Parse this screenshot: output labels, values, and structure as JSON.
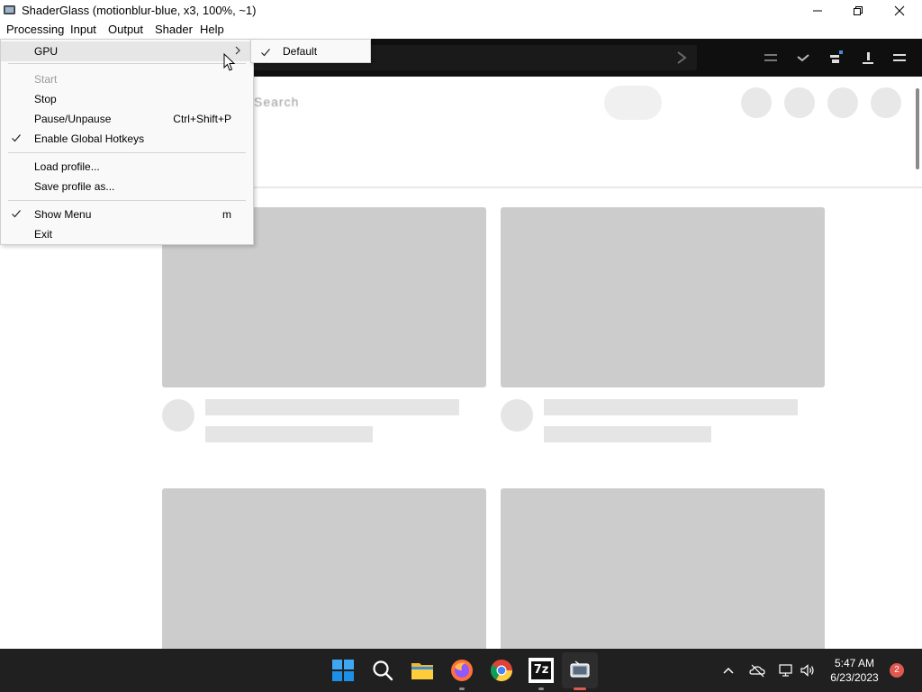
{
  "window": {
    "title": "ShaderGlass (motionblur-blue, x3, 100%, ~1)"
  },
  "menubar": {
    "items": [
      {
        "label": "Processing"
      },
      {
        "label": "Input"
      },
      {
        "label": "Output"
      },
      {
        "label": "Shader"
      },
      {
        "label": "Help"
      }
    ]
  },
  "processing_menu": {
    "items": [
      {
        "label": "GPU",
        "has_submenu": true,
        "highlighted": true
      },
      {
        "label": "Start",
        "disabled": true
      },
      {
        "label": "Stop"
      },
      {
        "label": "Pause/Unpause",
        "shortcut": "Ctrl+Shift+P"
      },
      {
        "label": "Enable Global Hotkeys",
        "checked": true
      },
      {
        "label": "Load profile..."
      },
      {
        "label": "Save profile as..."
      },
      {
        "label": "Show Menu",
        "shortcut": "m",
        "checked": true
      },
      {
        "label": "Exit"
      }
    ]
  },
  "gpu_submenu": {
    "items": [
      {
        "label": "Default",
        "checked": true
      }
    ]
  },
  "captured": {
    "logo_text": "Search"
  },
  "taskbar": {
    "apps": [
      {
        "icon": "windows-start-icon"
      },
      {
        "icon": "search-icon"
      },
      {
        "icon": "file-explorer-icon"
      },
      {
        "icon": "firefox-icon",
        "running": true
      },
      {
        "icon": "chrome-icon"
      },
      {
        "icon": "7zip-icon",
        "label": "7z",
        "running": true
      },
      {
        "icon": "shaderglass-icon",
        "active": true
      }
    ],
    "tray": {
      "icons": [
        "chevron-up-icon",
        "onedrive-icon",
        "network-icon",
        "volume-icon"
      ]
    },
    "clock": {
      "time": "5:47 AM",
      "date": "6/23/2023"
    },
    "notification_count": "2"
  },
  "colors": {
    "taskbar_bg": "#202020",
    "menu_highlight": "#e6e6e6",
    "active_indicator": "#e0584f",
    "placeholder_gray": "#cccccc"
  }
}
